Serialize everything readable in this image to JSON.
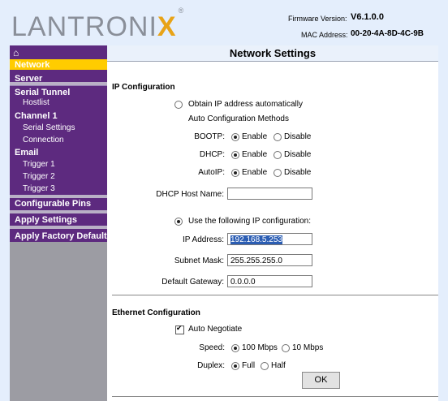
{
  "header": {
    "logo_text": "LANTRONIX",
    "registered": "®",
    "firmware_label": "Firmware Version:",
    "firmware_value": "V6.1.0.0",
    "mac_label": "MAC Address:",
    "mac_value": "00-20-4A-8D-4C-9B"
  },
  "nav": {
    "home_icon": "⌂",
    "items": {
      "network": "Network",
      "server": "Server",
      "serial_tunnel": "Serial Tunnel",
      "hostlist": "Hostlist",
      "channel1": "Channel 1",
      "serial_settings": "Serial Settings",
      "connection": "Connection",
      "email": "Email",
      "trigger1": "Trigger 1",
      "trigger2": "Trigger 2",
      "trigger3": "Trigger 3",
      "configurable_pins": "Configurable Pins",
      "apply_settings": "Apply Settings",
      "apply_factory": "Apply Factory Defaults"
    }
  },
  "main": {
    "title": "Network Settings",
    "ip_section": "IP Configuration",
    "obtain_auto": "Obtain IP address automatically",
    "auto_methods": "Auto Configuration Methods",
    "bootp_label": "BOOTP:",
    "dhcp_label": "DHCP:",
    "autoip_label": "AutoIP:",
    "enable": "Enable",
    "disable": "Disable",
    "dhcp_host_label": "DHCP Host Name:",
    "dhcp_host_value": "",
    "use_following": "Use the following IP configuration:",
    "ip_label": "IP Address:",
    "ip_value": "192.168.5.253",
    "mask_label": "Subnet Mask:",
    "mask_value": "255.255.255.0",
    "gateway_label": "Default Gateway:",
    "gateway_value": "0.0.0.0",
    "eth_section": "Ethernet Configuration",
    "auto_negotiate": "Auto Negotiate",
    "speed_label": "Speed:",
    "speed_100": "100 Mbps",
    "speed_10": "10 Mbps",
    "duplex_label": "Duplex:",
    "duplex_full": "Full",
    "duplex_half": "Half",
    "ok_label": "OK"
  }
}
